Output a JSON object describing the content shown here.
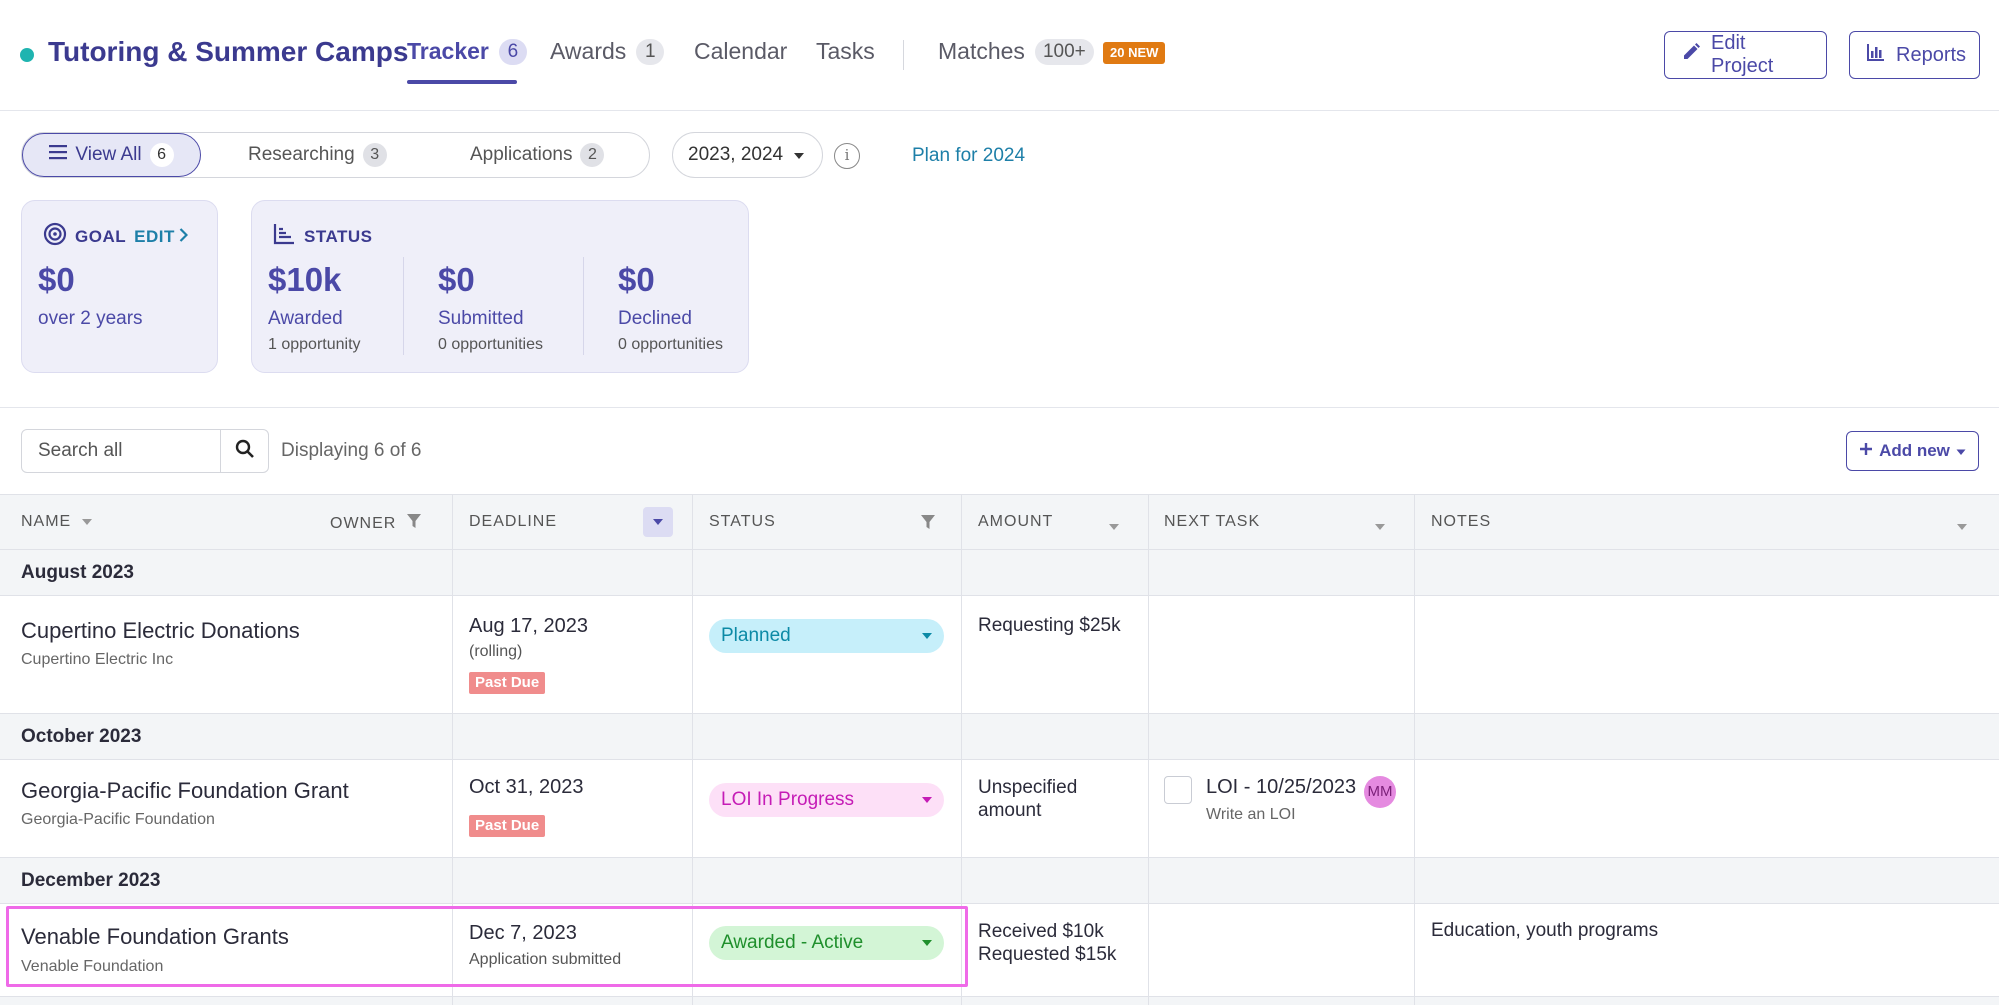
{
  "header": {
    "project_title": "Tutoring & Summer Camps",
    "tabs": [
      {
        "label": "Tracker",
        "count": "6"
      },
      {
        "label": "Awards",
        "count": "1"
      },
      {
        "label": "Calendar"
      },
      {
        "label": "Tasks"
      },
      {
        "label": "Matches",
        "count": "100+",
        "badge": "20 NEW"
      }
    ],
    "edit_project_label": "Edit Project",
    "reports_label": "Reports",
    "accent_color": "#4b49a7",
    "status_dot_color": "#1fb4b0"
  },
  "filters": {
    "views": [
      {
        "label": "View All",
        "count": "6"
      },
      {
        "label": "Researching",
        "count": "3"
      },
      {
        "label": "Applications",
        "count": "2"
      }
    ],
    "year_select": "2023, 2024",
    "plan_link": "Plan for 2024"
  },
  "goal_card": {
    "heading": "GOAL",
    "edit_label": "EDIT",
    "amount": "$0",
    "period": "over 2 years"
  },
  "status_card": {
    "heading": "STATUS",
    "metrics": [
      {
        "amount": "$10k",
        "label": "Awarded",
        "sub": "1 opportunity"
      },
      {
        "amount": "$0",
        "label": "Submitted",
        "sub": "0 opportunities"
      },
      {
        "amount": "$0",
        "label": "Declined",
        "sub": "0 opportunities"
      }
    ]
  },
  "search": {
    "placeholder": "Search all",
    "displaying": "Displaying 6 of 6"
  },
  "add_new_label": "Add new",
  "table": {
    "columns": {
      "name": "NAME",
      "owner": "OWNER",
      "deadline": "DEADLINE",
      "status": "STATUS",
      "amount": "AMOUNT",
      "next_task": "NEXT TASK",
      "notes": "NOTES"
    },
    "groups": [
      {
        "label": "August 2023",
        "rows": [
          {
            "name": "Cupertino Electric Donations",
            "org": "Cupertino Electric Inc",
            "deadline": "Aug 17, 2023",
            "deadline_sub": "(rolling)",
            "past_due": "Past Due",
            "status": "Planned",
            "amount_lines": [
              "Requesting $25k"
            ]
          }
        ]
      },
      {
        "label": "October 2023",
        "rows": [
          {
            "name": "Georgia-Pacific Foundation Grant",
            "org": "Georgia-Pacific Foundation",
            "deadline": "Oct 31, 2023",
            "past_due": "Past Due",
            "status": "LOI In Progress",
            "amount_lines": [
              "Unspecified",
              "amount"
            ],
            "task_title": "LOI - 10/25/2023",
            "task_sub": "Write an LOI",
            "task_owner": "MM"
          }
        ]
      },
      {
        "label": "December 2023",
        "rows": [
          {
            "name": "Venable Foundation Grants",
            "org": "Venable Foundation",
            "deadline": "Dec 7, 2023",
            "deadline_sub": "Application submitted",
            "status": "Awarded - Active",
            "amount_lines": [
              "Received $10k",
              "Requested $15k"
            ],
            "notes": "Education, youth programs"
          }
        ]
      }
    ],
    "status_colors": {
      "planned": "#c6effa",
      "loi": "#fde0f7",
      "awarded": "#d3f5d6"
    }
  }
}
